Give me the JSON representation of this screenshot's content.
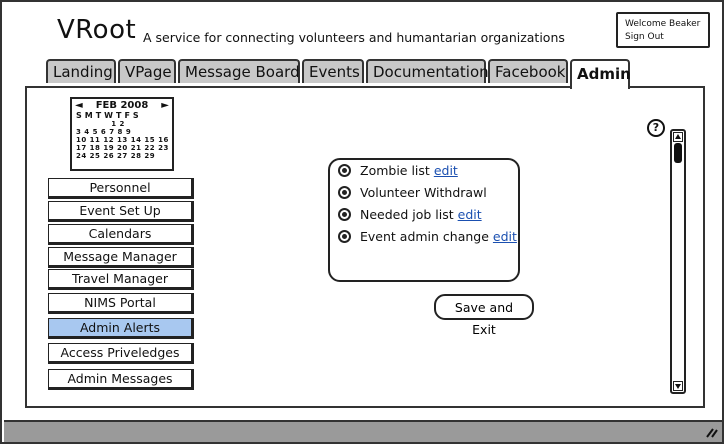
{
  "header": {
    "app_name": "VRoot",
    "tagline": "A service for connecting volunteers and humantarian organizations",
    "welcome": "Welcome Beaker",
    "sign_out": "Sign Out"
  },
  "tabs": [
    {
      "label": "Landing"
    },
    {
      "label": "VPage"
    },
    {
      "label": "Message Board"
    },
    {
      "label": "Events"
    },
    {
      "label": "Documentation"
    },
    {
      "label": "Facebook"
    },
    {
      "label": "Admin",
      "active": true
    }
  ],
  "calendar": {
    "month": "FEB 2008",
    "prev": "◄",
    "next": "►",
    "weekdays": "SMTWTFS",
    "rows": [
      "            1 2",
      "3 4 5 6 7 8 9",
      "10 11 12 13 14 15 16",
      "17 18 19 20 21 22 23",
      "24 25 26 27 28 29"
    ]
  },
  "sidebar": {
    "items": [
      {
        "label": "Personnel"
      },
      {
        "label": "Event Set Up"
      },
      {
        "label": "Calendars"
      },
      {
        "label": "Message Manager"
      },
      {
        "label": "Travel Manager"
      },
      {
        "label": "NIMS Portal"
      },
      {
        "label": "Admin Alerts",
        "selected": true
      },
      {
        "label": "Access Priveledges"
      },
      {
        "label": "Admin Messages"
      }
    ]
  },
  "alerts": {
    "items": [
      {
        "label": "Zombie list",
        "link": "edit"
      },
      {
        "label": "Volunteer Withdrawl",
        "link": ""
      },
      {
        "label": "Needed job list",
        "link": "edit"
      },
      {
        "label": "Event admin change",
        "link": "edit"
      }
    ]
  },
  "actions": {
    "save_exit": "Save and Exit"
  },
  "help": {
    "glyph": "?"
  },
  "colors": {
    "selected": "#a8c8f0",
    "link": "#1a4fb0",
    "tab_inactive": "#c8c8c8",
    "statusbar": "#9a9a9a"
  }
}
